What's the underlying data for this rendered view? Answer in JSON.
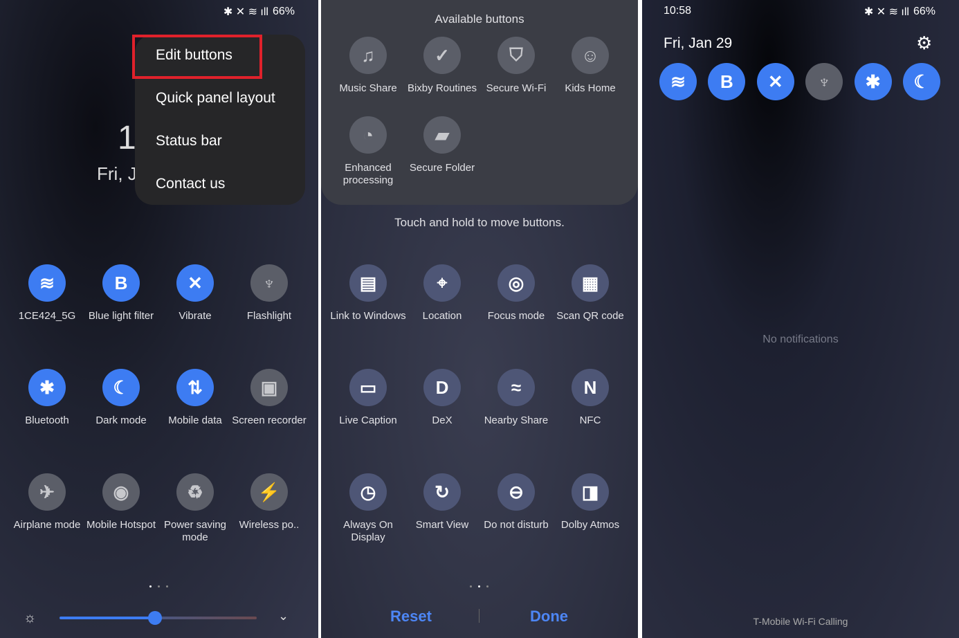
{
  "status_bar": {
    "battery": "66%",
    "icons": [
      "bluetooth-icon",
      "mute-vibrate-icon",
      "wifi-icon",
      "signal-icon",
      "battery-icon"
    ]
  },
  "colors": {
    "active_tile": "#3d7cf2",
    "inactive_tile": "#5b5e68",
    "highlight": "#e0212b",
    "accent_text": "#4d86f5"
  },
  "panel1": {
    "clock_partial": "1(",
    "date_partial": "Fri, J",
    "menu": [
      {
        "label": "Edit buttons",
        "highlighted": true
      },
      {
        "label": "Quick panel layout"
      },
      {
        "label": "Status bar"
      },
      {
        "label": "Contact us"
      }
    ],
    "tiles": [
      {
        "label": "1CE424_5G",
        "icon": "wifi-icon",
        "on": true
      },
      {
        "label": "Blue light filter",
        "icon": "blue-light-icon",
        "on": true
      },
      {
        "label": "Vibrate",
        "icon": "vibrate-icon",
        "on": true
      },
      {
        "label": "Flashlight",
        "icon": "flashlight-icon",
        "on": false
      },
      {
        "label": "Bluetooth",
        "icon": "bluetooth-icon",
        "on": true
      },
      {
        "label": "Dark mode",
        "icon": "moon-icon",
        "on": true
      },
      {
        "label": "Mobile data",
        "icon": "mobile-data-icon",
        "on": true
      },
      {
        "label": "Screen recorder",
        "icon": "screen-recorder-icon",
        "on": false
      },
      {
        "label": "Airplane mode",
        "icon": "airplane-icon",
        "on": false
      },
      {
        "label": "Mobile Hotspot",
        "icon": "hotspot-icon",
        "on": false
      },
      {
        "label": "Power saving mode",
        "icon": "power-saving-icon",
        "on": false
      },
      {
        "label": "Wireless po..",
        "icon": "wireless-powershare-icon",
        "on": false
      }
    ],
    "brightness": 0.6
  },
  "panel2": {
    "available_title": "Available buttons",
    "available": [
      {
        "label": "Music Share",
        "icon": "music-share-icon"
      },
      {
        "label": "Bixby Routines",
        "icon": "bixby-routines-icon"
      },
      {
        "label": "Secure Wi-Fi",
        "icon": "secure-wifi-icon"
      },
      {
        "label": "Kids Home",
        "icon": "kids-home-icon"
      },
      {
        "label": "Enhanced processing",
        "icon": "enhanced-processing-icon"
      },
      {
        "label": "Secure Folder",
        "icon": "secure-folder-icon"
      }
    ],
    "hint": "Touch and hold to move buttons.",
    "tiles": [
      {
        "label": "Link to Windows",
        "icon": "link-to-windows-icon"
      },
      {
        "label": "Location",
        "icon": "location-icon"
      },
      {
        "label": "Focus mode",
        "icon": "focus-mode-icon"
      },
      {
        "label": "Scan QR code",
        "icon": "qr-code-icon"
      },
      {
        "label": "Live Caption",
        "icon": "live-caption-icon"
      },
      {
        "label": "DeX",
        "icon": "dex-icon"
      },
      {
        "label": "Nearby Share",
        "icon": "nearby-share-icon"
      },
      {
        "label": "NFC",
        "icon": "nfc-icon"
      },
      {
        "label": "Always On Display",
        "icon": "always-on-display-icon"
      },
      {
        "label": "Smart View",
        "icon": "smart-view-icon"
      },
      {
        "label": "Do not disturb",
        "icon": "do-not-disturb-icon"
      },
      {
        "label": "Dolby Atmos",
        "icon": "dolby-atmos-icon"
      }
    ],
    "reset_label": "Reset",
    "done_label": "Done"
  },
  "panel3": {
    "time": "10:58",
    "date": "Fri, Jan 29",
    "quick": [
      {
        "icon": "wifi-icon",
        "on": true
      },
      {
        "icon": "blue-light-icon",
        "on": true
      },
      {
        "icon": "vibrate-icon",
        "on": true
      },
      {
        "icon": "flashlight-icon",
        "on": false
      },
      {
        "icon": "bluetooth-icon",
        "on": true
      },
      {
        "icon": "moon-icon",
        "on": true
      }
    ],
    "no_notifications": "No notifications",
    "carrier": "T-Mobile Wi-Fi Calling"
  }
}
